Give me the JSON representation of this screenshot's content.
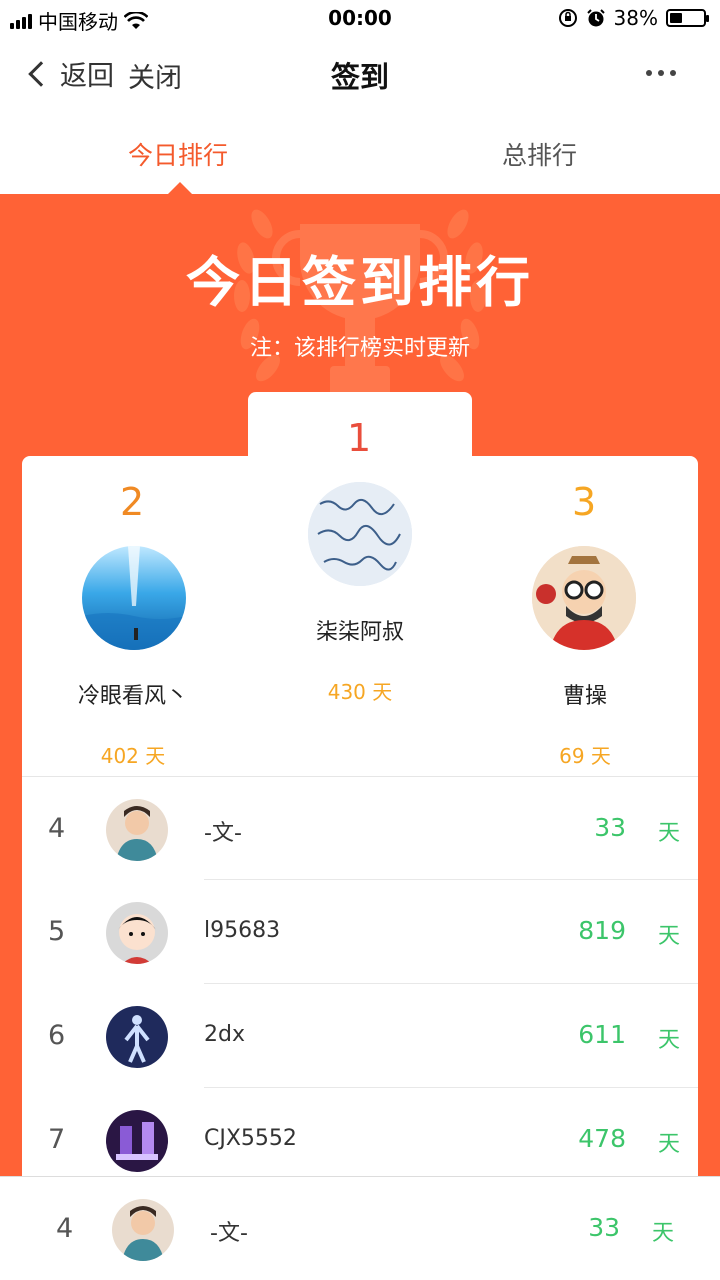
{
  "status_bar": {
    "carrier": "中国移动",
    "time": "00:00",
    "battery": "38%",
    "battery_level": 0.38,
    "icons": [
      "signal-icon",
      "wifi-icon",
      "rotation-lock-icon",
      "alarm-icon",
      "battery-icon"
    ]
  },
  "nav": {
    "back_label": "返回",
    "close_label": "关闭",
    "title": "签到",
    "more_icon": "more-dots-icon"
  },
  "tabs": [
    {
      "label": "今日排行",
      "active": true
    },
    {
      "label": "总排行",
      "active": false
    }
  ],
  "hero": {
    "title": "今日签到排行",
    "note": "注：该排行榜实时更新"
  },
  "podium": [
    {
      "rank": "1",
      "name": "柒柒阿叔",
      "days": "430 天",
      "color": "#e94e3c"
    },
    {
      "rank": "2",
      "name": "冷眼看风丶",
      "days": "402 天",
      "color": "#f08a24"
    },
    {
      "rank": "3",
      "name": "曹操",
      "days": "69 天",
      "color": "#f6a623"
    }
  ],
  "list": [
    {
      "rank": "4",
      "name": "-文-",
      "days": "33",
      "unit": "天"
    },
    {
      "rank": "5",
      "name": "l95683",
      "days": "819",
      "unit": "天"
    },
    {
      "rank": "6",
      "name": "2dx",
      "days": "611",
      "unit": "天"
    },
    {
      "rank": "7",
      "name": "CJX5552",
      "days": "478",
      "unit": "天"
    }
  ],
  "my_rank": {
    "rank": "4",
    "name": "-文-",
    "days": "33",
    "unit": "天"
  },
  "colors": {
    "accent": "#ff6236",
    "tab_active": "#f45a2c",
    "days_green": "#3cc56a",
    "days_gold": "#f6a623"
  }
}
